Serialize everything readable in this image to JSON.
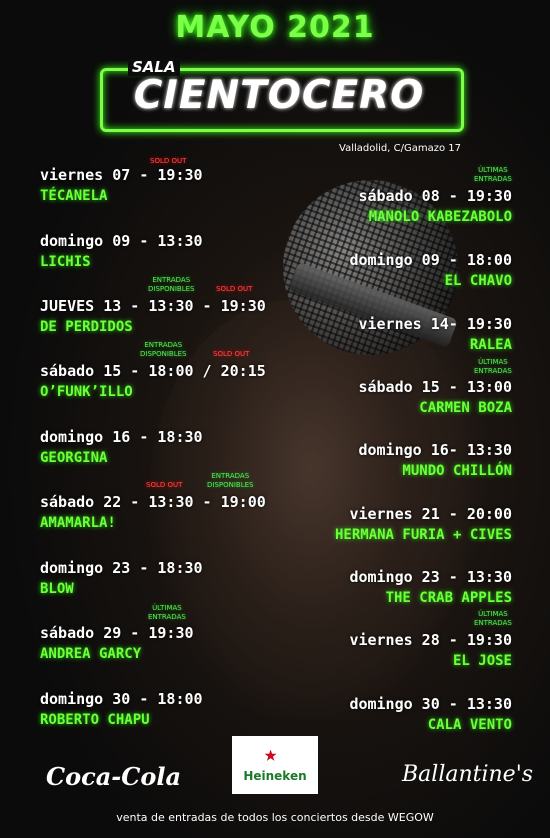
{
  "header": {
    "title": "MAYO 2021",
    "logo_prefix": "SALA",
    "logo_name": "CIENTOCERO",
    "address": "Valladolid, C/Gamazo 17"
  },
  "left_events": [
    {
      "date": "viernes 07 - 19:30",
      "artist": "TÉCANELA",
      "tag_sold": "SOLD OUT"
    },
    {
      "date": "domingo 09 - 13:30",
      "artist": "LICHIS"
    },
    {
      "date": "JUEVES 13 - 13:30 - 19:30",
      "artist": "DE PERDIDOS",
      "tag_disp": "ENTRADAS\nDISPONIBLES",
      "tag_sold": "SOLD OUT"
    },
    {
      "date": "sábado 15 - 18:00 / 20:15",
      "artist": "O’FUNK’ILLO",
      "tag_disp": "ENTRADAS\nDISPONIBLES",
      "tag_sold": "SOLD OUT"
    },
    {
      "date": "domingo 16 - 18:30",
      "artist": "GEORGINA"
    },
    {
      "date": "sábado 22 - 13:30 - 19:00",
      "artist": "AMAMARLA!",
      "tag_sold": "SOLD OUT",
      "tag_disp": "ENTRADAS\nDISPONIBLES"
    },
    {
      "date": "domingo 23 - 18:30",
      "artist": "BLOW"
    },
    {
      "date": "sábado 29 - 19:30",
      "artist": "ANDREA GARCY",
      "tag_ult": "ÚLTIMAS\nENTRADAS"
    },
    {
      "date": "domingo 30 - 18:00",
      "artist": "ROBERTO CHAPU"
    }
  ],
  "right_events": [
    {
      "date": "sábado 08 - 19:30",
      "artist": "MANOLO KABEZABOLO",
      "tag_ult": "ÚLTIMAS\nENTRADAS"
    },
    {
      "date": "domingo 09 - 18:00",
      "artist": "EL CHAVO"
    },
    {
      "date": "viernes 14- 19:30",
      "artist": "RALEA"
    },
    {
      "date": "sábado 15 - 13:00",
      "artist": "CARMEN BOZA",
      "tag_ult": "ÚLTIMAS\nENTRADAS"
    },
    {
      "date": "domingo 16- 13:30",
      "artist": "MUNDO CHILLÓN"
    },
    {
      "date": "viernes 21 - 20:00",
      "artist": "HERMANA FURIA + CIVES"
    },
    {
      "date": "domingo 23 - 13:30",
      "artist": "THE CRAB APPLES"
    },
    {
      "date": "viernes 28 - 19:30",
      "artist": "EL JOSE",
      "tag_ult": "ÚLTIMAS\nENTRADAS"
    },
    {
      "date": "domingo 30 - 13:30",
      "artist": "CALA VENTO"
    }
  ],
  "sponsors": {
    "coca_cola": "Coca-Cola",
    "heineken": "Heineken",
    "ballantines": "Ballantine's"
  },
  "footer": "venta de entradas de todos los conciertos desde WEGOW"
}
